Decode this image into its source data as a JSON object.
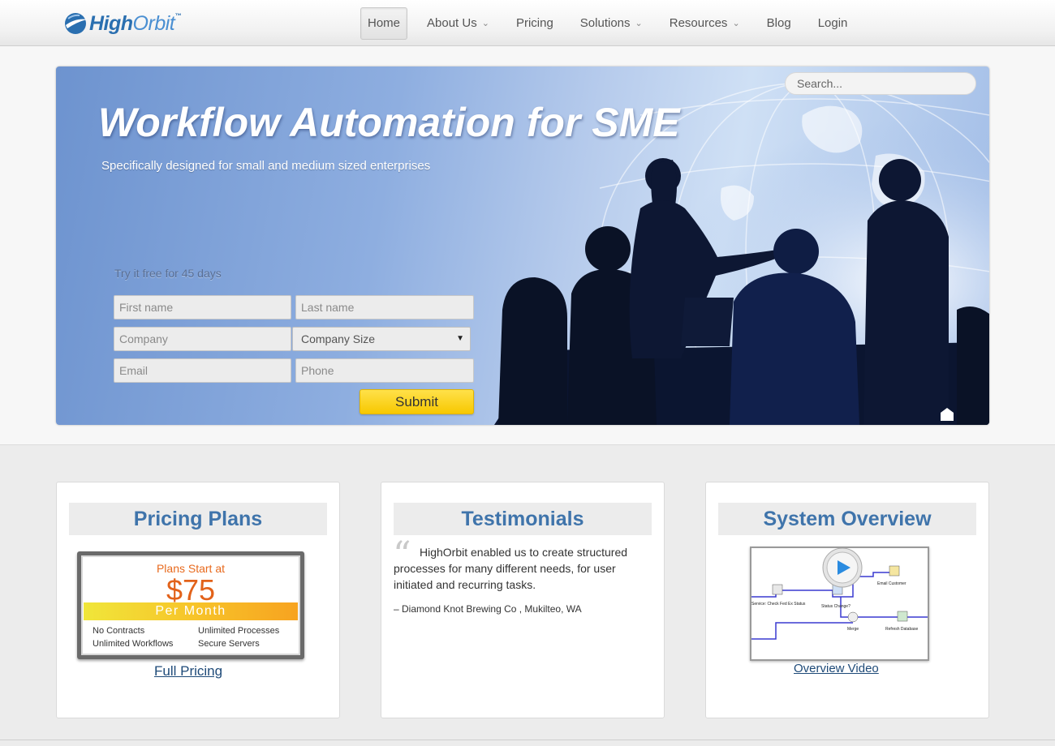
{
  "brand": {
    "name_bold": "High",
    "name_light": "Orbit",
    "tm": "™"
  },
  "nav": {
    "items": [
      {
        "label": "Home",
        "active": true,
        "dropdown": false
      },
      {
        "label": "About Us",
        "active": false,
        "dropdown": true
      },
      {
        "label": "Pricing",
        "active": false,
        "dropdown": false
      },
      {
        "label": "Solutions",
        "active": false,
        "dropdown": true
      },
      {
        "label": "Resources",
        "active": false,
        "dropdown": true
      },
      {
        "label": "Blog",
        "active": false,
        "dropdown": false
      },
      {
        "label": "Login",
        "active": false,
        "dropdown": false
      }
    ]
  },
  "search": {
    "placeholder": "Search..."
  },
  "hero": {
    "title": "Workflow Automation for SME",
    "subtitle": "Specifically designed for small and medium sized enterprises"
  },
  "signup": {
    "label": "Try it free for 45 days",
    "first_name_placeholder": "First name",
    "last_name_placeholder": "Last name",
    "company_placeholder": "Company",
    "company_size_selected": "Company Size",
    "email_placeholder": "Email",
    "phone_placeholder": "Phone",
    "submit_label": "Submit"
  },
  "pricing": {
    "title": "Pricing Plans",
    "card_top": "Plans Start at",
    "card_price": "$75",
    "card_period": "Per Month",
    "features": [
      "No Contracts",
      "Unlimited Processes",
      "Unlimited Workflows",
      "Secure Servers"
    ],
    "link": "Full Pricing"
  },
  "testimonials": {
    "title": "Testimonials",
    "quote": "HighOrbit enabled us to create structured processes for many different needs, for user initiated and recurring tasks.",
    "author": "– Diamond Knot Brewing Co , Mukilteo, WA"
  },
  "overview": {
    "title": "System Overview",
    "diagram_labels": [
      "Email Customer",
      "Service: Check Fed Ex Status",
      "Status Change?",
      "Merge",
      "Refresh Database"
    ],
    "link": "Overview Video"
  },
  "colors": {
    "accent_blue": "#3f74ab",
    "submit_yellow": "#f7c800",
    "price_orange": "#e2621a"
  }
}
